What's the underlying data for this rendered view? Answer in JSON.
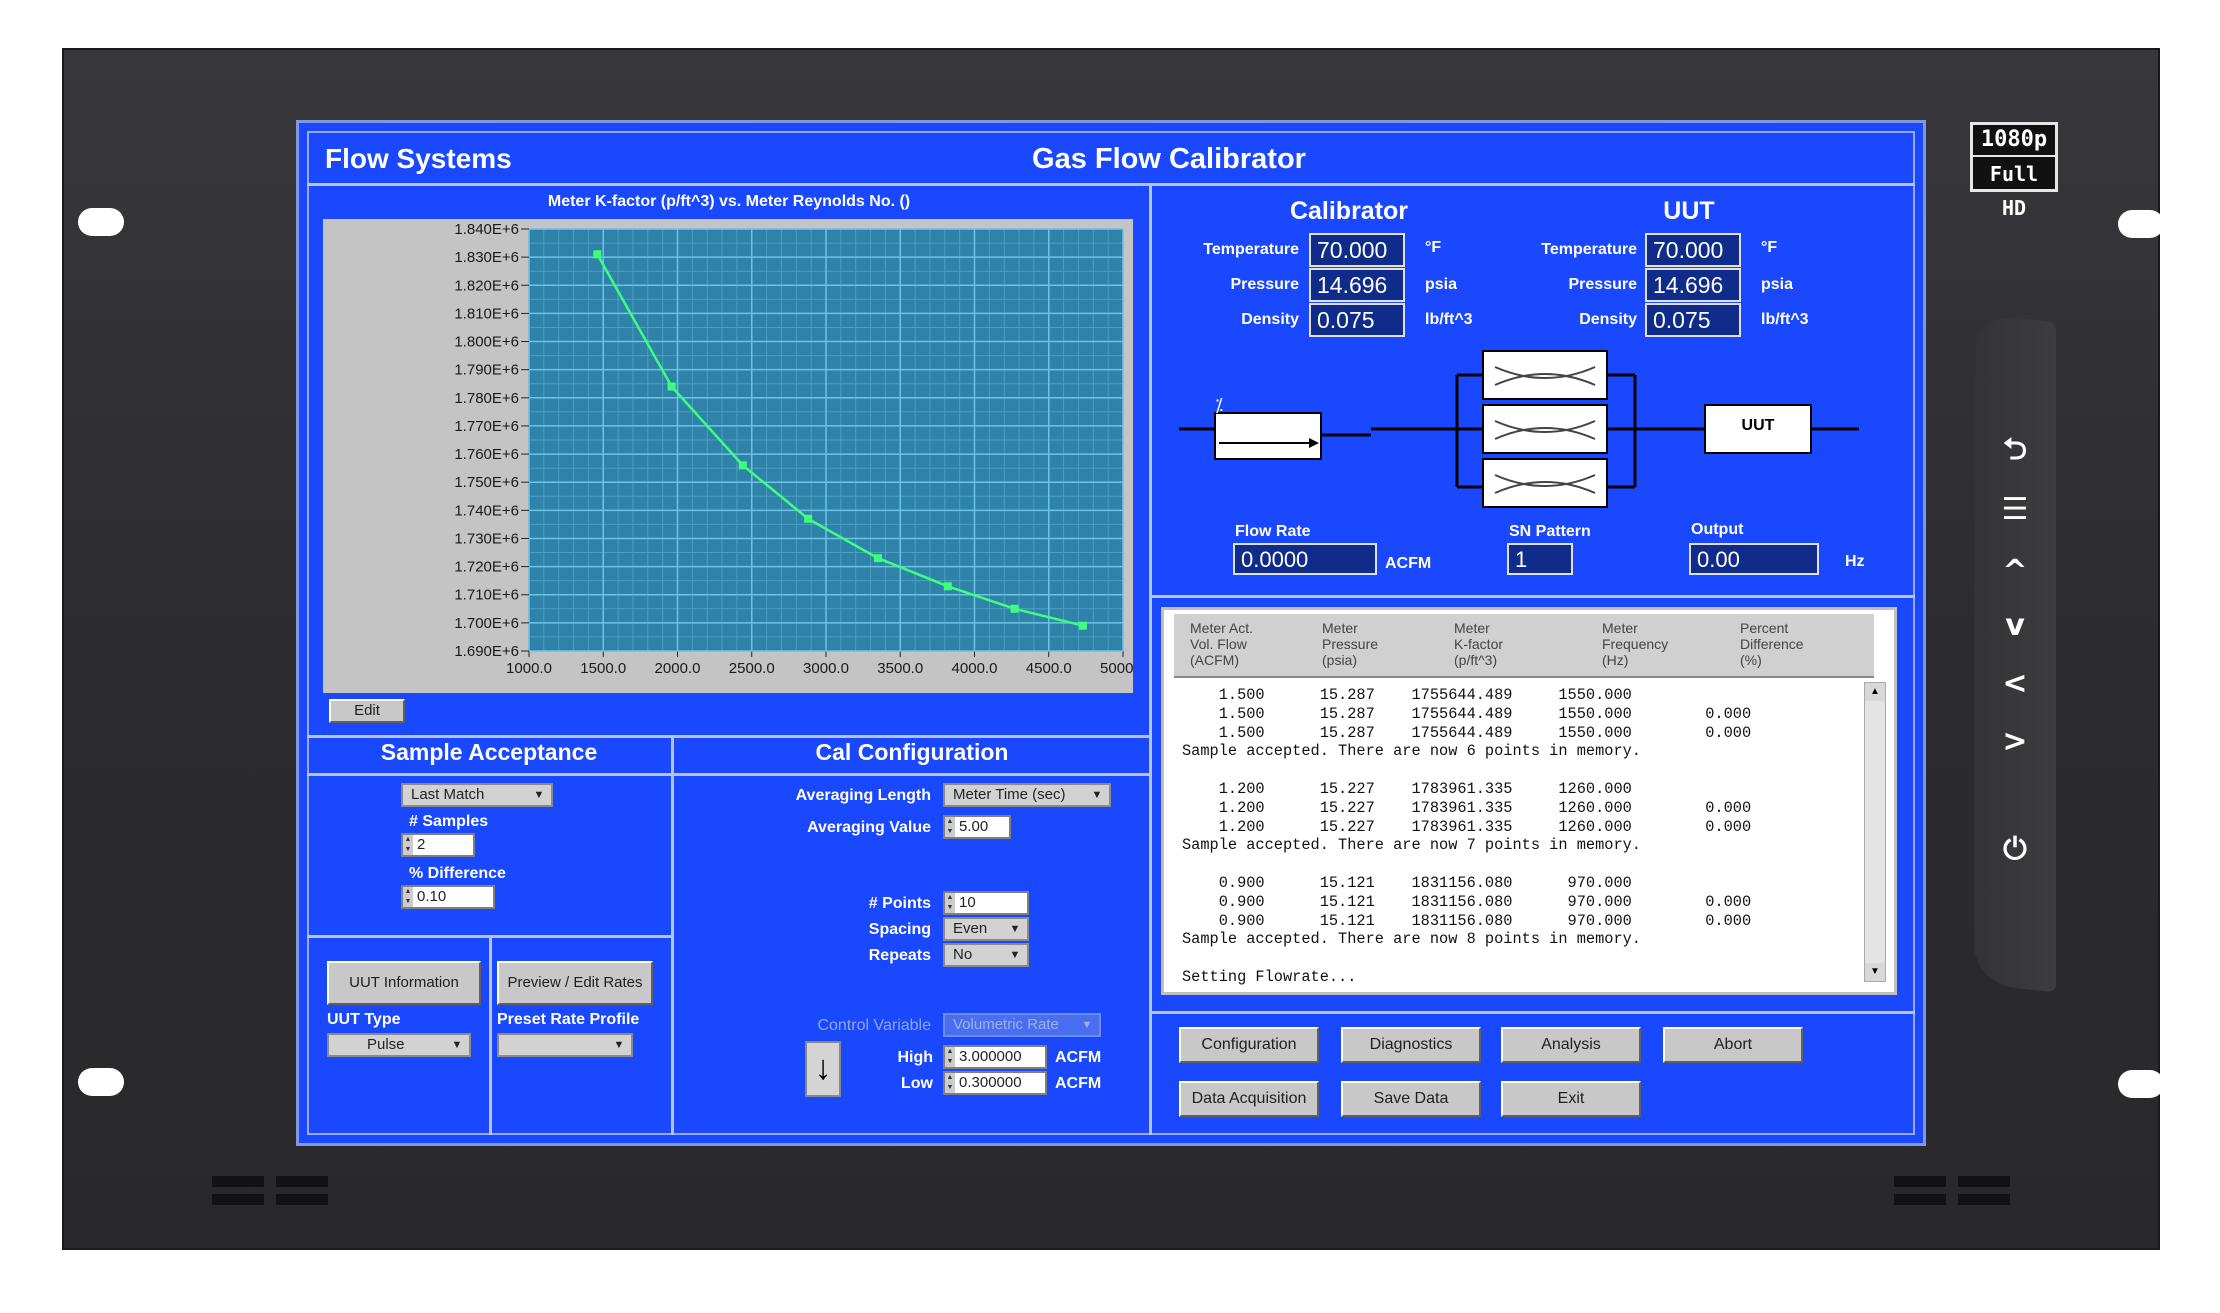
{
  "device": {
    "badge_line1": "1080p",
    "badge_line2": "Full HD",
    "side_buttons": [
      "back-icon",
      "menu-icon",
      "up-icon",
      "down-icon",
      "left-icon",
      "right-icon",
      "power-icon"
    ],
    "side_glyphs": [
      "⮌",
      "☰",
      "^",
      "v",
      "<",
      ">",
      "⏻"
    ]
  },
  "app": {
    "company": "Flow Systems",
    "title": "Gas Flow Calibrator"
  },
  "chart_data": {
    "type": "line",
    "title": "Meter K-factor (p/ft^3) vs. Meter Reynolds No. ()",
    "xlim": [
      1000,
      5000
    ],
    "ylim": [
      1690000,
      1840000
    ],
    "x_ticks": [
      "1000.0",
      "1500.0",
      "2000.0",
      "2500.0",
      "3000.0",
      "3500.0",
      "4000.0",
      "4500.0",
      "5000.0"
    ],
    "y_ticks": [
      "1.840E+6",
      "1.830E+6",
      "1.820E+6",
      "1.810E+6",
      "1.800E+6",
      "1.790E+6",
      "1.780E+6",
      "1.770E+6",
      "1.760E+6",
      "1.750E+6",
      "1.740E+6",
      "1.730E+6",
      "1.720E+6",
      "1.710E+6",
      "1.700E+6",
      "1.690E+6"
    ],
    "series": [
      {
        "x": [
          1460,
          1960,
          2440,
          2880,
          3350,
          3820,
          4270,
          4730
        ],
        "y": [
          1831000,
          1784000,
          1756000,
          1737000,
          1723000,
          1713000,
          1705000,
          1699000
        ]
      }
    ],
    "grid": true,
    "line_color": "#3dff7a",
    "plot_bg": "#2f82a8"
  },
  "chart_edit_button": "Edit",
  "calibrator": {
    "title": "Calibrator",
    "temperature_label": "Temperature",
    "temperature": "70.000",
    "temperature_unit": "°F",
    "pressure_label": "Pressure",
    "pressure": "14.696",
    "pressure_unit": "psia",
    "density_label": "Density",
    "density": "0.075",
    "density_unit": "lb/ft^3"
  },
  "uut": {
    "title": "UUT",
    "temperature_label": "Temperature",
    "temperature": "70.000",
    "temperature_unit": "°F",
    "pressure_label": "Pressure",
    "pressure": "14.696",
    "pressure_unit": "psia",
    "density_label": "Density",
    "density": "0.075",
    "density_unit": "lb/ft^3",
    "box_label": "UUT"
  },
  "readouts": {
    "flow_rate_label": "Flow Rate",
    "flow_rate": "0.0000",
    "flow_rate_unit": "ACFM",
    "sn_pattern_label": "SN Pattern",
    "sn_pattern": "1",
    "output_label": "Output",
    "output": "0.00",
    "output_unit": "Hz"
  },
  "results": {
    "headers": [
      [
        "Meter Act.",
        "Vol. Flow",
        "(ACFM)"
      ],
      [
        "Meter",
        "Pressure",
        "(psia)"
      ],
      [
        "Meter",
        "K-factor",
        "(p/ft^3)"
      ],
      [
        "Meter",
        "Frequency",
        "(Hz)"
      ],
      [
        "Percent",
        "Difference",
        "(%)"
      ]
    ],
    "log": [
      "    1.500      15.287    1755644.489     1550.000",
      "    1.500      15.287    1755644.489     1550.000        0.000",
      "    1.500      15.287    1755644.489     1550.000        0.000",
      "Sample accepted. There are now 6 points in memory.",
      "",
      "    1.200      15.227    1783961.335     1260.000",
      "    1.200      15.227    1783961.335     1260.000        0.000",
      "    1.200      15.227    1783961.335     1260.000        0.000",
      "Sample accepted. There are now 7 points in memory.",
      "",
      "    0.900      15.121    1831156.080      970.000",
      "    0.900      15.121    1831156.080      970.000        0.000",
      "    0.900      15.121    1831156.080      970.000        0.000",
      "Sample accepted. There are now 8 points in memory.",
      "",
      "Setting Flowrate..."
    ]
  },
  "sample_acceptance": {
    "title": "Sample Acceptance",
    "mode": "Last Match",
    "samples_label": "# Samples",
    "samples": "2",
    "difference_label": "% Difference",
    "difference": "0.10"
  },
  "cal_config": {
    "title": "Cal Configuration",
    "averaging_length_label": "Averaging Length",
    "averaging_length": "Meter Time (sec)",
    "averaging_value_label": "Averaging Value",
    "averaging_value": "5.00",
    "points_label": "# Points",
    "points": "10",
    "spacing_label": "Spacing",
    "spacing": "Even",
    "repeats_label": "Repeats",
    "repeats": "No",
    "control_variable_label": "Control Variable",
    "control_variable": "Volumetric Rate",
    "high_label": "High",
    "high": "3.000000",
    "high_unit": "ACFM",
    "low_label": "Low",
    "low": "0.300000",
    "low_unit": "ACFM"
  },
  "uut_panel": {
    "info_button": "UUT Information",
    "type_label": "UUT Type",
    "type": "Pulse",
    "preview_button": "Preview / Edit Rates",
    "preset_label": "Preset Rate Profile",
    "preset": ""
  },
  "actions": {
    "configuration": "Configuration",
    "diagnostics": "Diagnostics",
    "analysis": "Analysis",
    "abort": "Abort",
    "data_acquisition": "Data Acquisition",
    "save_data": "Save Data",
    "exit": "Exit"
  }
}
